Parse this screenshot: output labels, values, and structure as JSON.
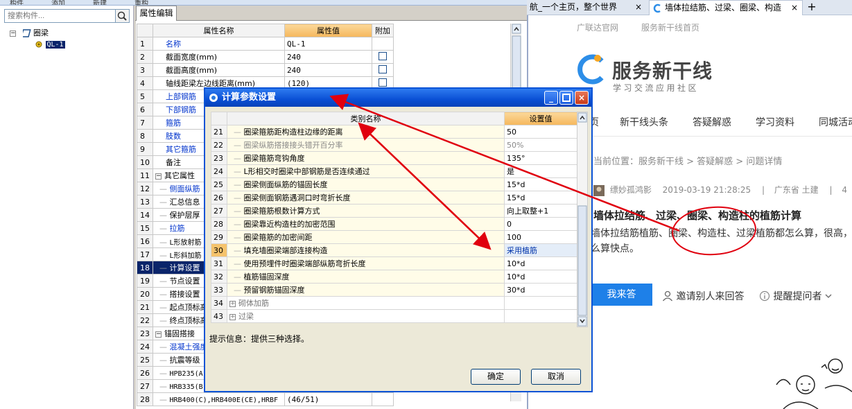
{
  "top_strip": [
    "构件",
    "添加",
    "新建",
    "重构"
  ],
  "left": {
    "search_placeholder": "搜索构件...",
    "tree": {
      "root": "圈梁",
      "child": "QL-1"
    }
  },
  "props": {
    "tab": "属性编辑",
    "headers": {
      "name": "属性名称",
      "value": "属性值",
      "extra": "附加"
    },
    "rows": [
      {
        "n": "1",
        "name": "名称",
        "value": "QL-1",
        "blue": true,
        "check": false
      },
      {
        "n": "2",
        "name": "截面宽度(mm)",
        "value": "240",
        "check": true
      },
      {
        "n": "3",
        "name": "截面高度(mm)",
        "value": "240",
        "check": true
      },
      {
        "n": "4",
        "name": "轴线距梁左边线距离(mm)",
        "value": "(120)",
        "check": true
      },
      {
        "n": "5",
        "name": "上部钢筋",
        "value": "",
        "blue": true
      },
      {
        "n": "6",
        "name": "下部钢筋",
        "value": "",
        "blue": true
      },
      {
        "n": "7",
        "name": "箍筋",
        "value": "",
        "blue": true
      },
      {
        "n": "8",
        "name": "肢数",
        "value": "",
        "blue": true
      },
      {
        "n": "9",
        "name": "其它箍筋",
        "value": "",
        "blue": true
      },
      {
        "n": "10",
        "name": "备注",
        "value": ""
      },
      {
        "n": "11",
        "name": "其它属性",
        "value": "",
        "group": true
      },
      {
        "n": "12",
        "name": "侧面纵筋",
        "value": "",
        "blue": true,
        "indent": true
      },
      {
        "n": "13",
        "name": "汇总信息",
        "value": "",
        "indent": true
      },
      {
        "n": "14",
        "name": "保护层厚",
        "value": "",
        "indent": true
      },
      {
        "n": "15",
        "name": "拉筋",
        "value": "",
        "blue": true,
        "indent": true
      },
      {
        "n": "16",
        "name": "L形放射筋",
        "value": "",
        "indent": true
      },
      {
        "n": "17",
        "name": "L形斜加筋",
        "value": "",
        "indent": true
      },
      {
        "n": "18",
        "name": "计算设置",
        "value": "",
        "indent": true,
        "selected": true
      },
      {
        "n": "19",
        "name": "节点设置",
        "value": "",
        "indent": true
      },
      {
        "n": "20",
        "name": "搭接设置",
        "value": "",
        "indent": true
      },
      {
        "n": "21",
        "name": "起点顶标高",
        "value": "",
        "indent": true
      },
      {
        "n": "22",
        "name": "终点顶标高",
        "value": "",
        "indent": true
      },
      {
        "n": "23",
        "name": "锚固搭接",
        "value": "",
        "group": true
      },
      {
        "n": "24",
        "name": "混凝土强度等级",
        "value": "",
        "blue": true,
        "indent": true
      },
      {
        "n": "25",
        "name": "抗震等级",
        "value": "",
        "indent": true
      },
      {
        "n": "26",
        "name": "HPB235(A)",
        "value": "",
        "indent": true
      },
      {
        "n": "27",
        "name": "HRB335(B)",
        "value": "",
        "indent": true
      },
      {
        "n": "28",
        "name": "HRB400(C),HRB400E(CE),HRBF",
        "value": "(46/51)",
        "indent": true
      }
    ]
  },
  "browser": {
    "tab1": "航_一个主页，整个世界",
    "tab2": "墙体拉结筋、过梁、圈梁、构造",
    "close": "×",
    "new_tab": "+",
    "toplinks": [
      "广联达官网",
      "服务新干线首页"
    ],
    "logo": {
      "title": "服务新干线",
      "sub": "学习交流应用社区"
    },
    "nav": [
      "页",
      "新干线头条",
      "答疑解惑",
      "学习资料",
      "同城活动"
    ],
    "breadcrumb": "当前位置：服务新干线 > 答疑解惑 > 问题详情",
    "meta": {
      "user": "缥妙孤鸿影",
      "time": "2019-03-19 21:28:25",
      "sep": "|",
      "location": "广东省 土建",
      "sep2": "|",
      "count": "4"
    },
    "question_title": "墙体拉结筋、过梁、圈梁、构造柱的植筋计算",
    "question_body": "墙体拉结筋植筋、圈梁、构造柱、过梁植筋都怎么算，很高，怎么算快点。",
    "answer_button": "我来答",
    "invite": "邀请别人来回答",
    "remind": "提醒提问者"
  },
  "dialog": {
    "title": "计算参数设置",
    "headers": {
      "name": "类别名称",
      "value": "设置值"
    },
    "rows": [
      {
        "n": "21",
        "name": "圈梁箍筋距构造柱边缘的距离",
        "value": "50"
      },
      {
        "n": "22",
        "name": "圈梁纵筋搭接接头错开百分率",
        "value": "50%",
        "dim": true
      },
      {
        "n": "23",
        "name": "圈梁箍筋弯钩角度",
        "value": "135°"
      },
      {
        "n": "24",
        "name": "L形相交时圈梁中部钢筋是否连续通过",
        "value": "是"
      },
      {
        "n": "25",
        "name": "圈梁侧面纵筋的锚固长度",
        "value": "15*d"
      },
      {
        "n": "26",
        "name": "圈梁侧面钢筋遇洞口时弯折长度",
        "value": "15*d"
      },
      {
        "n": "27",
        "name": "圈梁箍筋根数计算方式",
        "value": "向上取整+1"
      },
      {
        "n": "28",
        "name": "圈梁靠近构造柱的加密范围",
        "value": "0"
      },
      {
        "n": "29",
        "name": "圈梁箍筋的加密间距",
        "value": "100"
      },
      {
        "n": "30",
        "name": "填充墙圈梁端部连接构造",
        "value": "采用植筋",
        "current": true
      },
      {
        "n": "31",
        "name": "使用预埋件时圈梁端部纵筋弯折长度",
        "value": "10*d"
      },
      {
        "n": "32",
        "name": "植筋锚固深度",
        "value": "10*d"
      },
      {
        "n": "33",
        "name": "预留钢筋锚固深度",
        "value": "30*d"
      },
      {
        "n": "34",
        "name": "砌体加筋",
        "value": "",
        "group": true
      },
      {
        "n": "43",
        "name": "过梁",
        "value": "",
        "group": true
      }
    ],
    "hint": "提示信息：提供三种选择。",
    "ok": "确定",
    "cancel": "取消",
    "expand_glyph": "+",
    "minimize_glyph": "_",
    "close_glyph": "×"
  },
  "colors": {
    "annotation": "#e0000f",
    "selection": "#0a246a",
    "header_accent": "#f5b75c",
    "answer_button": "#1e80e8"
  }
}
